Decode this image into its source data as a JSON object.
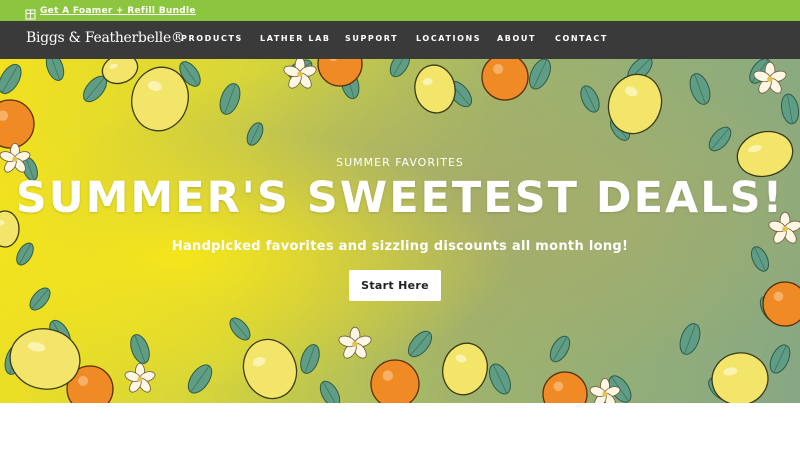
{
  "promo": {
    "icon": "gift-icon",
    "link_label": "Get A Foamer + Refill Bundle"
  },
  "header": {
    "logo_text": "Biggs & Featherbelle®",
    "nav": [
      {
        "label": "PRODUCTS"
      },
      {
        "label": "LATHER LAB"
      },
      {
        "label": "SUPPORT"
      },
      {
        "label": "LOCATIONS"
      },
      {
        "label": "ABOUT"
      },
      {
        "label": "CONTACT"
      }
    ]
  },
  "hero": {
    "eyebrow": "SUMMER FAVORITES",
    "title": "SUMMER'S SWEETEST DEALS!",
    "subtitle": "Handpicked favorites and sizzling discounts all month long!",
    "cta_label": "Start Here"
  },
  "colors": {
    "promo_bg": "#8cc63f",
    "header_bg": "#3a3a3a",
    "lemon": "#f2e56a",
    "orange": "#f08a24",
    "leaf": "#5f9d84",
    "blossom": "#fff6e3"
  }
}
